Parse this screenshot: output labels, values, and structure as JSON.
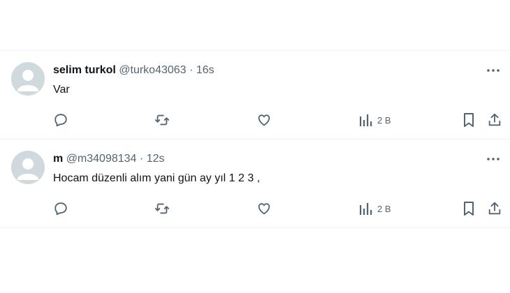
{
  "tweets": [
    {
      "name": "selim turkol",
      "handle": "@turko43063",
      "separator": "·",
      "time": "16s",
      "text": "Var",
      "views": "2 B"
    },
    {
      "name": "m",
      "handle": "@m34098134",
      "separator": "·",
      "time": "12s",
      "text": "Hocam düzenli alım yani gün ay yıl 1 2 3 ,",
      "views": "2 B"
    }
  ],
  "colors": {
    "text": "#0f1419",
    "muted": "#536471",
    "divider": "#eff3f4",
    "avatar_bg": "#cfd9de"
  },
  "icons": [
    "reply-icon",
    "retweet-icon",
    "like-icon",
    "views-icon",
    "bookmark-icon",
    "share-icon",
    "more-icon"
  ]
}
